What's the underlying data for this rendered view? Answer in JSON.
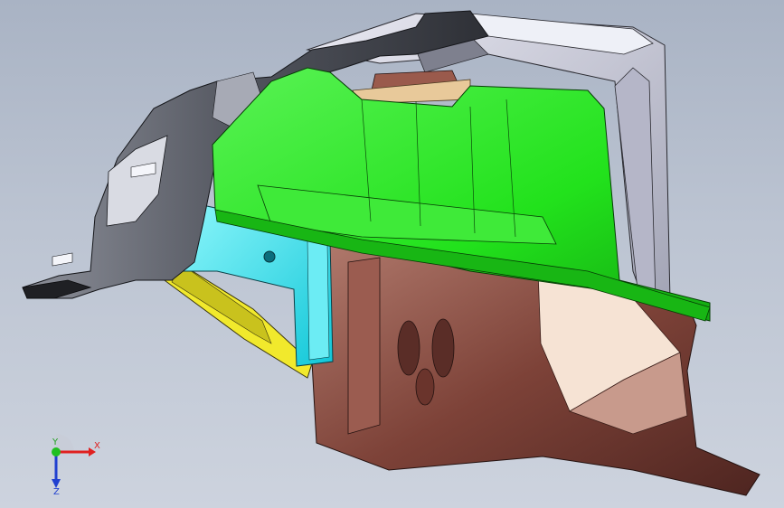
{
  "viewport": {
    "background_top": "#a9b3c4",
    "background_bottom": "#cdd3de"
  },
  "parts": [
    {
      "name": "dark-grey-panel",
      "color": "#5a5e68"
    },
    {
      "name": "light-grey-shell",
      "color": "#c8c9d6"
    },
    {
      "name": "green-panel",
      "color": "#22e61c"
    },
    {
      "name": "cyan-bracket",
      "color": "#19e8f0"
    },
    {
      "name": "yellow-rail",
      "color": "#f2ea2a"
    },
    {
      "name": "brown-housing",
      "color": "#8a4a40"
    }
  ],
  "triad": {
    "x_label": "X",
    "y_label": "Y",
    "z_label": "Z",
    "x_color": "#e02020",
    "y_color": "#20c020",
    "z_color": "#2040d0"
  }
}
